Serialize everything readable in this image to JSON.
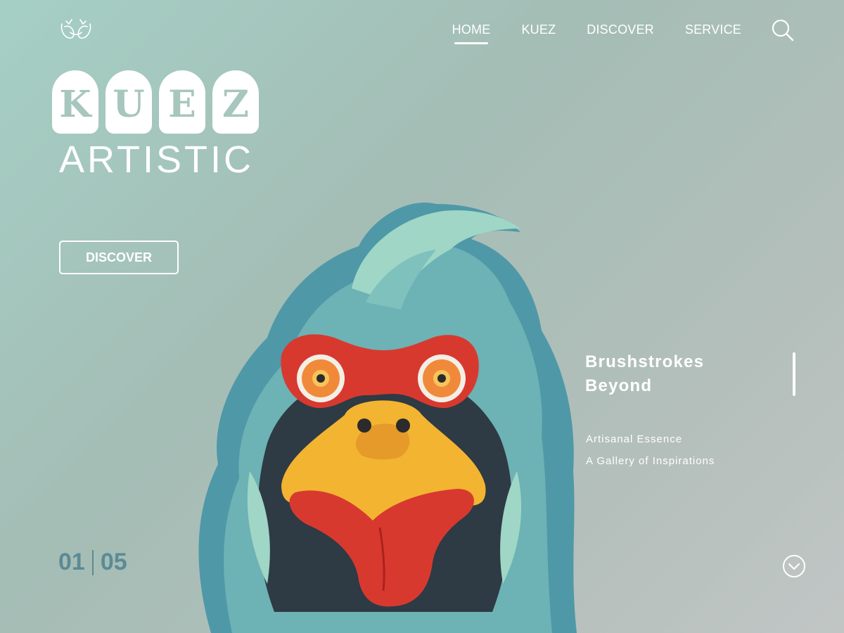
{
  "nav": {
    "items": [
      {
        "label": "HOME",
        "active": true
      },
      {
        "label": "KUEZ",
        "active": false
      },
      {
        "label": "DISCOVER",
        "active": false
      },
      {
        "label": "SERVICE",
        "active": false
      }
    ],
    "search_icon": "search-icon"
  },
  "brand": {
    "logo_icon": "bird-pair-logo",
    "letters": [
      "K",
      "U",
      "E",
      "Z"
    ],
    "subtitle": "ARTISTIC"
  },
  "hero": {
    "cta_label": "DISCOVER",
    "headline_line1": "Brushstrokes",
    "headline_line2": "Beyond",
    "sub1": "Artisanal Essence",
    "sub2": "A Gallery of Inspirations"
  },
  "pager": {
    "current": "01",
    "total": "05"
  },
  "scroll_icon": "chevron-down-circle-icon",
  "colors": {
    "background_start": "#a5cfc5",
    "background_end": "#c1c6c5",
    "pager": "#5b8b95",
    "brand_letter_text": "#a7c6bd",
    "feather_blue": "#4f98a8",
    "feather_light": "#9fd6c6",
    "comb_red": "#d8392f",
    "beak_yellow": "#f2b431"
  }
}
